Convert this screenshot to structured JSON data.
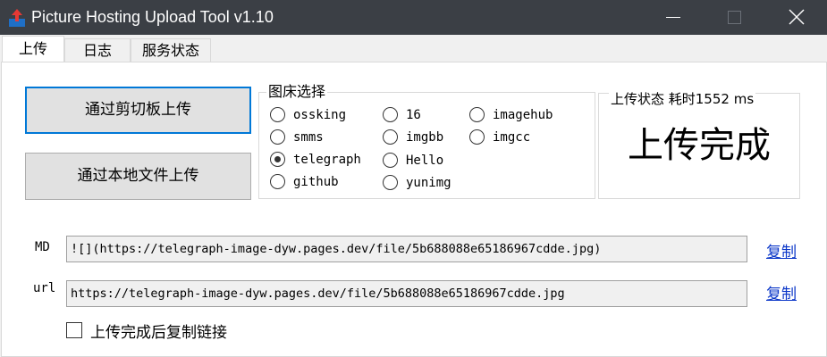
{
  "window": {
    "title": "Picture Hosting Upload Tool v1.10",
    "icon": "upload-arrow-icon",
    "titlebar_color": "#3b3f45",
    "controls": [
      "minimize-icon",
      "maximize-icon",
      "close-icon"
    ]
  },
  "tabs": [
    {
      "label": "上传",
      "active": true
    },
    {
      "label": "日志",
      "active": false
    },
    {
      "label": "服务状态",
      "active": false
    }
  ],
  "buttons": {
    "clipboard_upload": "通过剪切板上传",
    "local_file_upload": "通过本地文件上传"
  },
  "host_selection": {
    "legend": "图床选择",
    "selected": "telegraph",
    "options": [
      "ossking",
      "smms",
      "telegraph",
      "github",
      "16",
      "imgbb",
      "Hello",
      "yunimg",
      "imagehub",
      "imgcc"
    ]
  },
  "upload_status": {
    "legend": "上传状态 耗时1552 ms",
    "message": "上传完成"
  },
  "md_field": {
    "label": "MD",
    "value": "![](https://telegraph-image-dyw.pages.dev/file/5b688088e65186967cdde.jpg)",
    "copy_label": "复制"
  },
  "url_field": {
    "label": "url",
    "value": "https://telegraph-image-dyw.pages.dev/file/5b688088e65186967cdde.jpg",
    "copy_label": "复制"
  },
  "auto_copy": {
    "label": "上传完成后复制链接",
    "checked": false
  },
  "colors": {
    "focus_border": "#0078d7",
    "link": "#0a36c8"
  }
}
